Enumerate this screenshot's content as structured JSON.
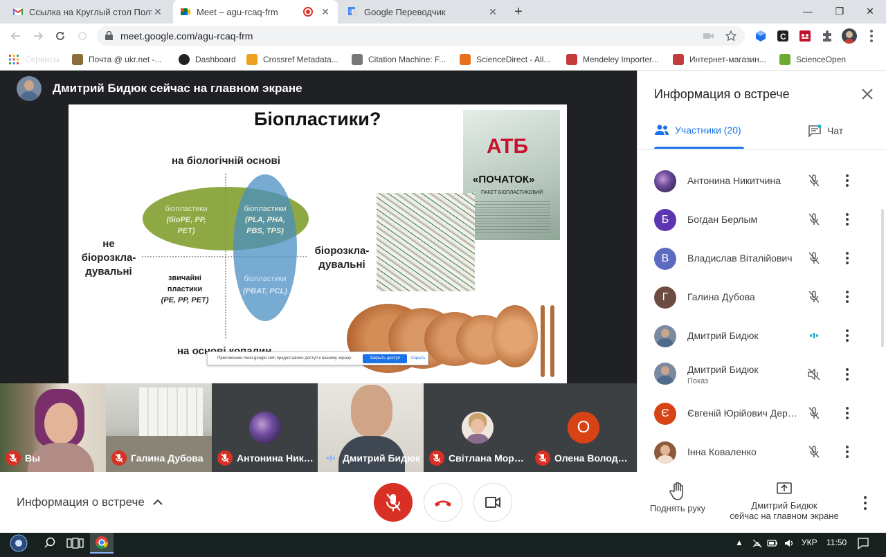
{
  "browser": {
    "tabs": [
      {
        "title": "Ссылка на Круглый стол Полтав",
        "close": "✕"
      },
      {
        "title": "Meet – agu-rcaq-frm",
        "close": "✕"
      },
      {
        "title": "Google Переводчик",
        "close": "✕"
      }
    ],
    "new_tab": "+",
    "window": {
      "minimize": "—",
      "restore": "❐",
      "close": "✕"
    },
    "url": "meet.google.com/agu-rcaq-frm",
    "bookmarks": [
      {
        "label": "Почта @ ukr.net -...",
        "color": "#8a6d3b"
      },
      {
        "label": "Dashboard",
        "color": "#222222"
      },
      {
        "label": "Crossref Metadata...",
        "color": "#f0a020"
      },
      {
        "label": "Citation Machine: F...",
        "color": "#777777"
      },
      {
        "label": "ScienceDirect - All...",
        "color": "#e8701a"
      },
      {
        "label": "Mendeley Importer...",
        "color": "#c43b3b"
      },
      {
        "label": "Интернет-магазин...",
        "color": "#c43b3b"
      },
      {
        "label": "ScienceOpen",
        "color": "#6bab2f"
      }
    ],
    "apps_label": "Сервисы"
  },
  "meet": {
    "presenter_title": "Дмитрий Бидюк сейчас на главном экране",
    "slide": {
      "title": "Біопластики?",
      "top_axis": "на біологічній основі",
      "bottom_axis": "на основі копалин",
      "left_axis": [
        "не",
        "біорозкла-",
        "дувальні"
      ],
      "right_axis": [
        "біорозкла-",
        "дувальні"
      ],
      "q1": [
        "біопластики",
        "(біоPE, PP,",
        "PET)"
      ],
      "q2": [
        "біопластики",
        "(PLA, PHA,",
        "PBS, TPS)"
      ],
      "q3": [
        "звичайні",
        "пластики",
        "(PE, PP, PET)"
      ],
      "q4": [
        "біопластики",
        "(PBAT, PCL)"
      ],
      "bag_brand": "АТБ",
      "bag_label": "«ПОЧАТОК»",
      "bag_sub": "ПАКЕТ БІОПЛАСТИКОВИЙ",
      "share_notice": "Приложению meet.google.com предоставлен доступ к вашему экрану.",
      "share_stop": "Закрыть доступ",
      "share_hide": "Скрыть"
    },
    "tiles": [
      {
        "name": "Вы",
        "muted": true
      },
      {
        "name": "Галина Дубова",
        "muted": true
      },
      {
        "name": "Антонина Никитчина",
        "muted": true
      },
      {
        "name": "Дмитрий Бидюк",
        "muted": false
      },
      {
        "name": "Світлана Морозова",
        "muted": true
      },
      {
        "name": "Олена Володимирівна",
        "muted": true,
        "initial": "О"
      }
    ],
    "panel": {
      "title": "Информация о встрече",
      "tab_people": "Участники (20)",
      "tab_chat": "Чат",
      "people": [
        {
          "name": "Антонина Никитчина",
          "initial": "",
          "color": "#4a3a7a",
          "mic": "muted"
        },
        {
          "name": "Богдан Берлым",
          "initial": "Б",
          "color": "#5e35b1",
          "mic": "muted"
        },
        {
          "name": "Владислав Віталійович",
          "initial": "В",
          "color": "#5c6bc0",
          "mic": "muted"
        },
        {
          "name": "Галина Дубова",
          "initial": "Г",
          "color": "#6d4c41",
          "mic": "muted"
        },
        {
          "name": "Дмитрий Бидюк",
          "initial": "",
          "color": "#7a8aa0",
          "mic": "speaking"
        },
        {
          "name": "Дмитрий Бидюк",
          "sub": "Показ",
          "initial": "",
          "color": "#7a8aa0",
          "mic": "off"
        },
        {
          "name": "Євгеній Юрійович Дерев'янко",
          "initial": "Є",
          "color": "#d84315",
          "mic": "muted"
        },
        {
          "name": "Інна Коваленко",
          "initial": "",
          "color": "#8d5a3b",
          "mic": "muted"
        }
      ]
    },
    "bottom": {
      "meeting_info": "Информация о встрече",
      "raise_hand": "Поднять руку",
      "presenting": [
        "Дмитрий Бидюк",
        "сейчас на главном экране"
      ]
    }
  },
  "taskbar": {
    "lang": "УКР",
    "time": "11:50"
  }
}
